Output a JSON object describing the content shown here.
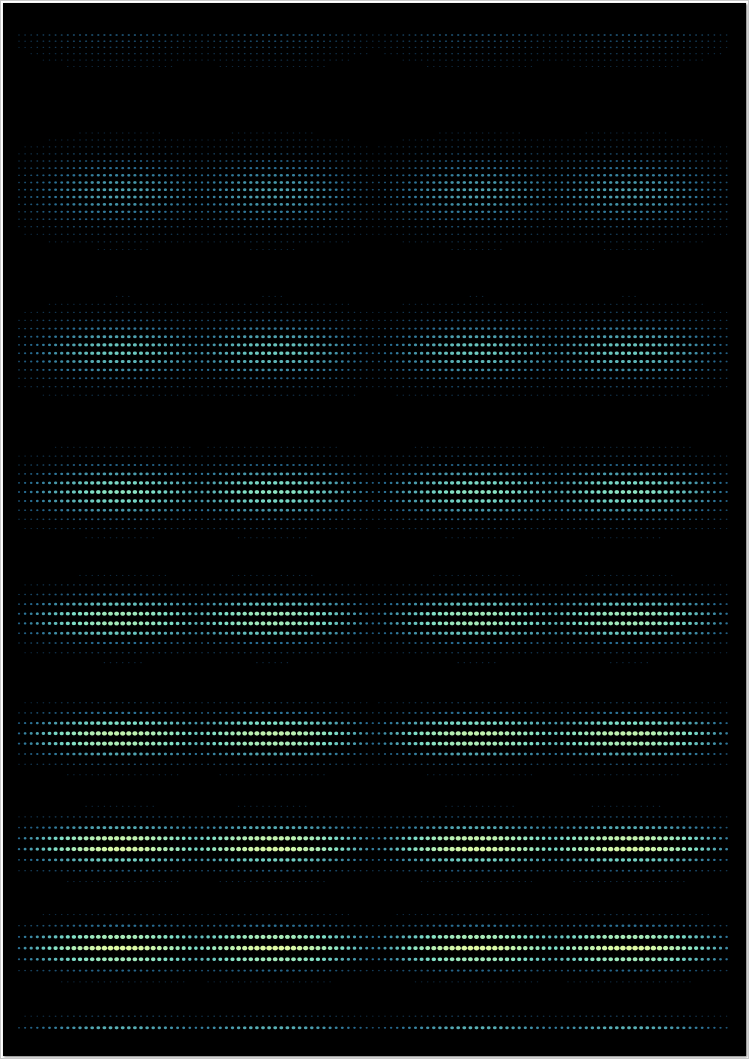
{
  "artwork": {
    "description_free": true,
    "background_color": "#000000",
    "palette": {
      "bright": "#f4ff9c",
      "mid": "#7fe0c8",
      "dim": "#3a9fd8",
      "faint": "#1f5f9a"
    },
    "pattern": {
      "column_groups": 4,
      "pulse_bands": 5
    }
  }
}
